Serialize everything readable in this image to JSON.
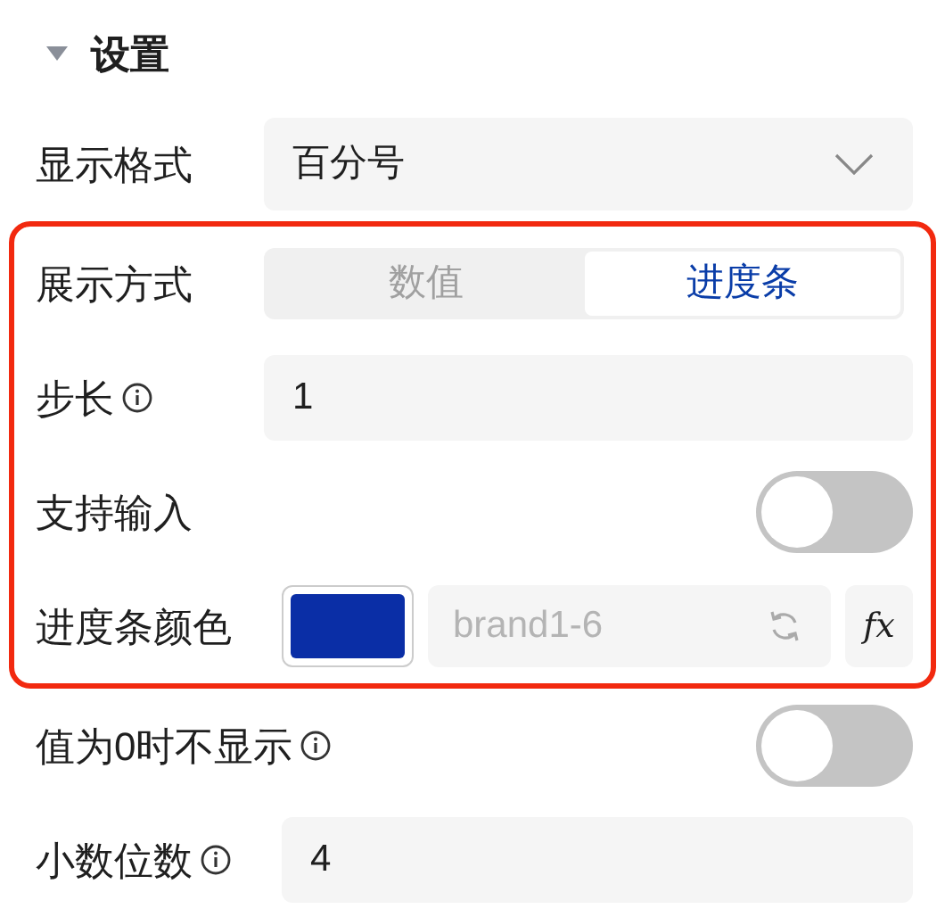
{
  "section": {
    "title": "设置",
    "expanded": true
  },
  "rows": [
    {
      "kind": "select",
      "label": "显示格式",
      "info": false,
      "highlighted": false,
      "value": "百分号"
    },
    {
      "kind": "segmented",
      "label": "展示方式",
      "info": false,
      "highlighted": true,
      "options": [
        {
          "label": "数值",
          "selected": false
        },
        {
          "label": "进度条",
          "selected": true
        }
      ]
    },
    {
      "kind": "input",
      "label": "步长",
      "info": true,
      "highlighted": true,
      "value": "1"
    },
    {
      "kind": "toggle",
      "label": "支持输入",
      "info": false,
      "highlighted": true,
      "on": false
    },
    {
      "kind": "color",
      "label": "进度条颜色",
      "info": false,
      "highlighted": true,
      "color": "#0a2ea6",
      "value": "brand1-6",
      "disabled": true,
      "formula": "fx"
    },
    {
      "kind": "toggle",
      "label": "值为0时不显示",
      "info": true,
      "highlighted": false,
      "on": false
    },
    {
      "kind": "input",
      "label": "小数位数",
      "info": true,
      "highlighted": false,
      "value": "4"
    }
  ]
}
